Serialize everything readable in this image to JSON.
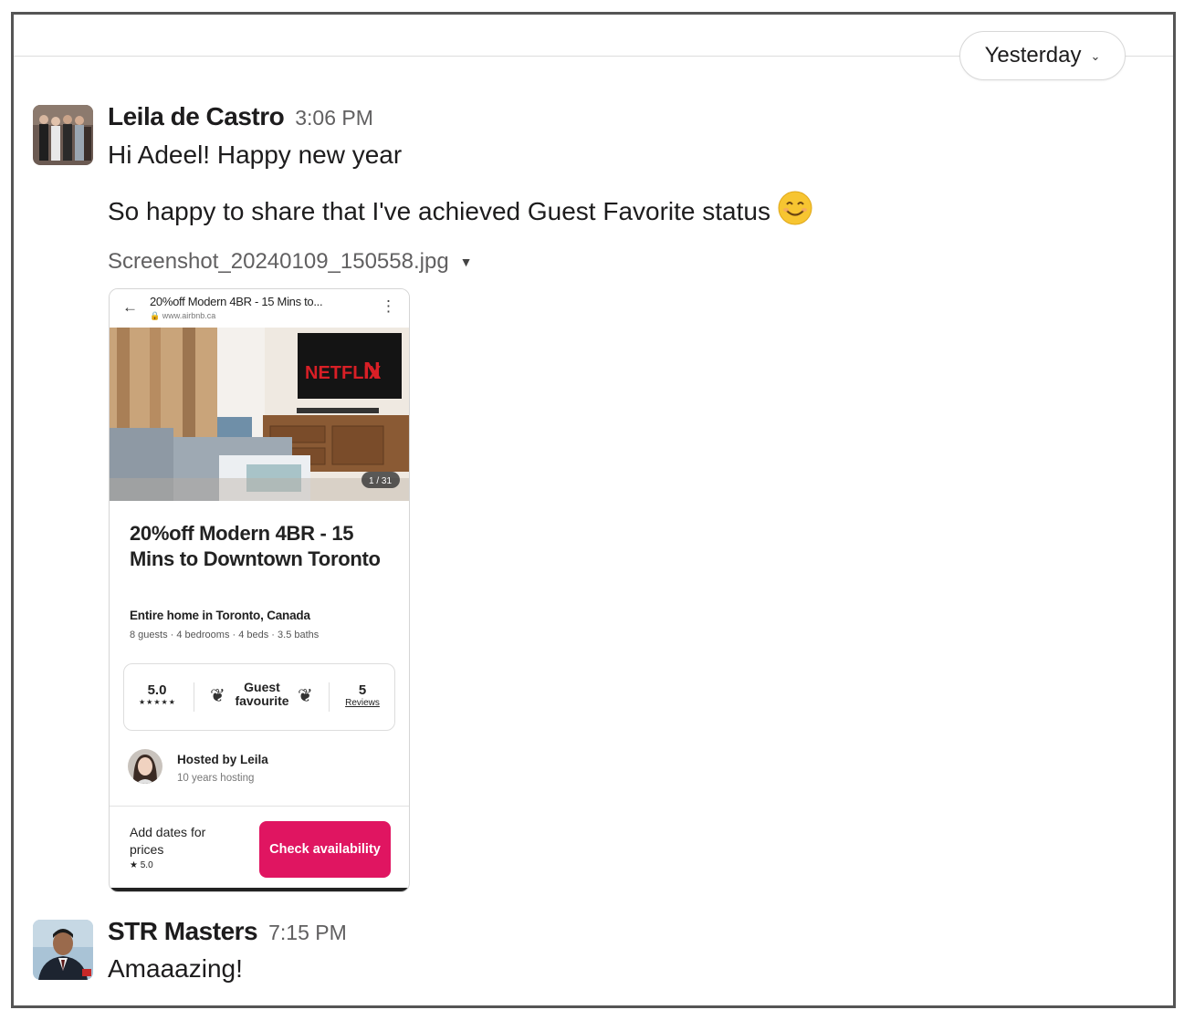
{
  "date_divider": {
    "label": "Yesterday"
  },
  "messages": [
    {
      "author": "Leila de Castro",
      "time": "3:06 PM",
      "lines": [
        "Hi Adeel! Happy new year",
        "So happy to share that I've achieved Guest Favorite status"
      ],
      "emoji": "😊",
      "attachment": {
        "file_name": "Screenshot_20240109_150558.jpg",
        "screenshot": {
          "browser_title": "20%off Modern 4BR - 15 Mins to...",
          "browser_url": "www.airbnb.ca",
          "photo_counter": "1 / 31",
          "tv_text": "NETFLIX",
          "tv_logo": "N",
          "listing_title": "20%off Modern 4BR - 15 Mins to Downtown Toronto",
          "subtitle": "Entire home in Toronto, Canada",
          "details": "8 guests · 4 bedrooms · 4 beds · 3.5 baths",
          "rating": "5.0",
          "rating_stars": "★★★★★",
          "badge": "Guest favourite",
          "reviews_count": "5",
          "reviews_label": "Reviews",
          "host_name": "Hosted by Leila",
          "host_years": "10 years hosting",
          "footer_text": "Add dates for prices",
          "footer_rating": "★ 5.0",
          "button": "Check availability"
        }
      }
    },
    {
      "author": "STR Masters",
      "time": "7:15 PM",
      "lines": [
        "Amaaazing!"
      ]
    }
  ],
  "colors": {
    "accent": "#e01561",
    "text": "#1d1c1d",
    "muted": "#616061"
  }
}
